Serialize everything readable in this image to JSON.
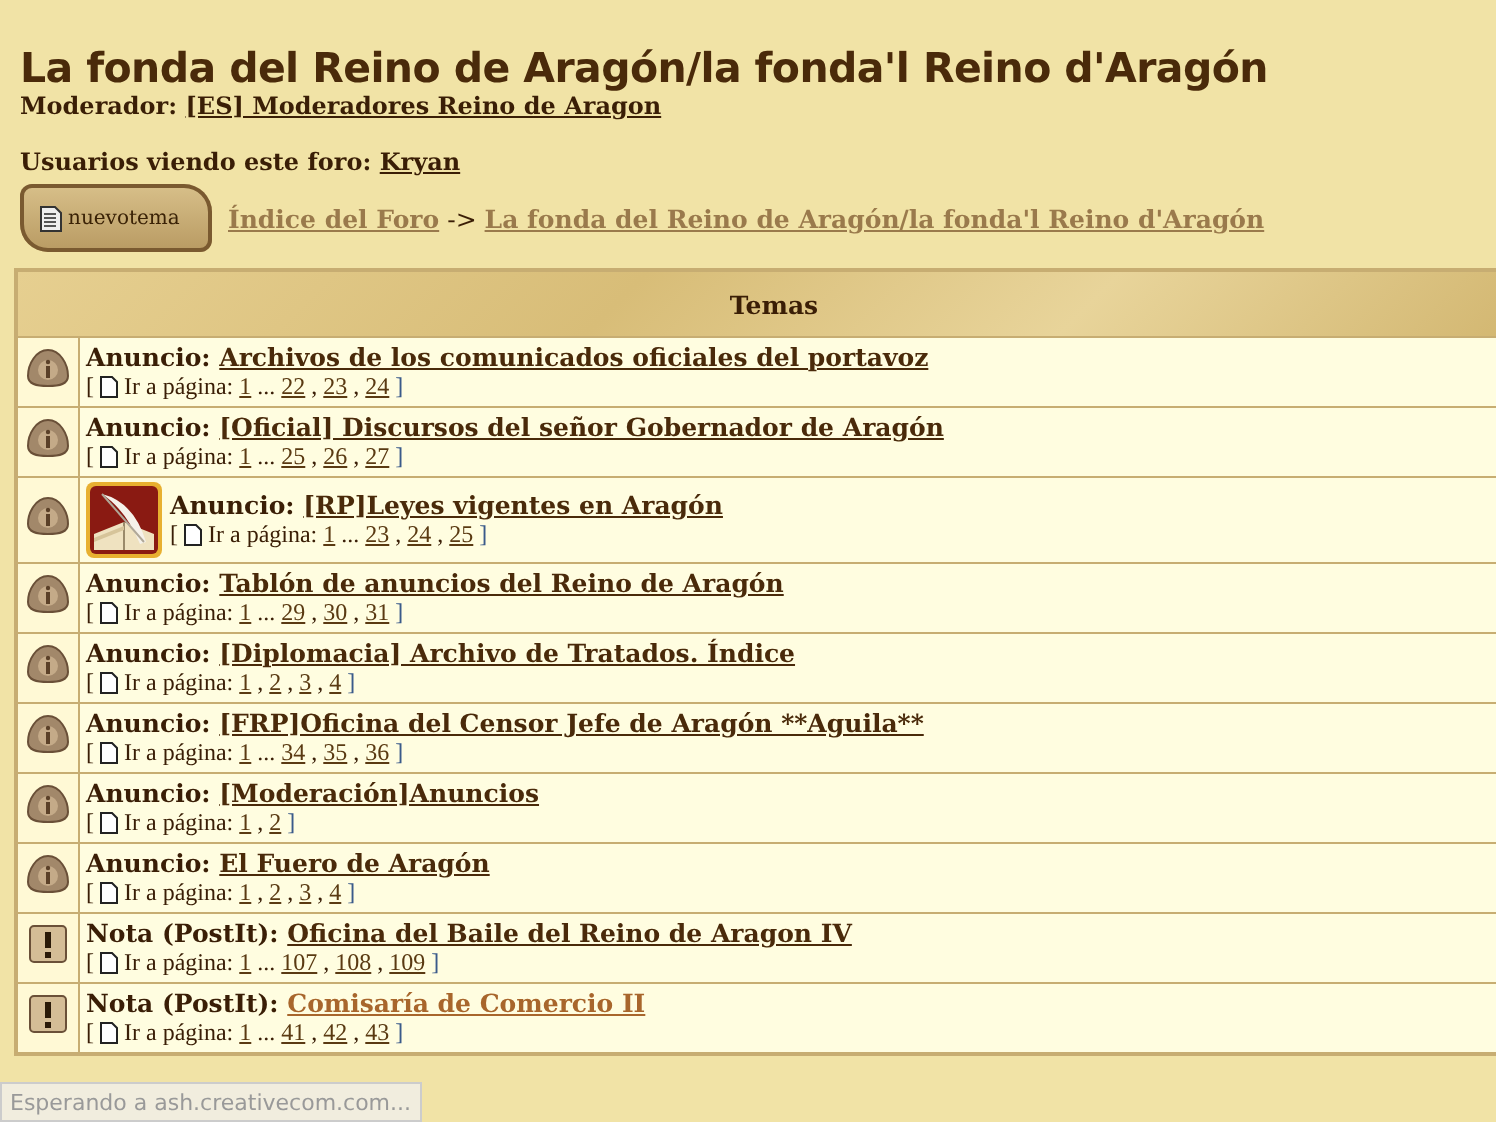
{
  "forum": {
    "title": "La fonda del Reino de Aragón/la fonda'l Reino d'Aragón",
    "moderator_label": "Moderador:",
    "moderator": "[ES] Moderadores Reino de Aragon",
    "viewers_label": "Usuarios viendo este foro:",
    "viewer": "Kryan"
  },
  "new_topic_button": "nuevotema",
  "breadcrumb": [
    {
      "label": "Índice del Foro "
    },
    {
      "label": "La fonda del Reino de Aragón/la fonda'l Reino d'Aragón"
    }
  ],
  "breadcrumb_separator": "->",
  "table": {
    "header": "Temas",
    "open_bracket": "[",
    "close_bracket": "]",
    "page_separator": ",",
    "rows": [
      {
        "kind": "announcement",
        "prefix": "Anuncio:",
        "title": "Archivos de los comunicados oficiales del portavoz",
        "goto": "Ir a página:",
        "pages": [
          "1",
          "...",
          "22",
          "23",
          "24"
        ],
        "highlighted": false
      },
      {
        "kind": "announcement",
        "prefix": "Anuncio:",
        "title": "[Oficial] Discursos del señor Gobernador de Aragón",
        "goto": "Ir a página:",
        "pages": [
          "1",
          "...",
          "25",
          "26",
          "27"
        ],
        "highlighted": false
      },
      {
        "kind": "announcement",
        "prefix": "Anuncio:",
        "title": "[RP]Leyes vigentes en Aragón",
        "goto": "Ir a página:",
        "pages": [
          "1",
          "...",
          "23",
          "24",
          "25"
        ],
        "highlighted": false
      },
      {
        "kind": "announcement",
        "prefix": "Anuncio:",
        "title": "Tablón de anuncios del Reino de Aragón",
        "goto": "Ir a página:",
        "pages": [
          "1",
          "...",
          "29",
          "30",
          "31"
        ],
        "highlighted": false
      },
      {
        "kind": "announcement",
        "prefix": "Anuncio:",
        "title": "[Diplomacia] Archivo de Tratados. Índice",
        "goto": "Ir a página:",
        "pages": [
          "1",
          "2",
          "3",
          "4"
        ],
        "highlighted": false
      },
      {
        "kind": "announcement",
        "prefix": "Anuncio:",
        "title": "[FRP]Oficina del Censor Jefe de Aragón **Aguila**",
        "goto": "Ir a página:",
        "pages": [
          "1",
          "...",
          "34",
          "35",
          "36"
        ],
        "highlighted": false
      },
      {
        "kind": "announcement",
        "prefix": "Anuncio:",
        "title": "[Moderación]Anuncios",
        "goto": "Ir a página:",
        "pages": [
          "1",
          "2"
        ],
        "highlighted": false
      },
      {
        "kind": "announcement",
        "prefix": "Anuncio:",
        "title": "El Fuero de Aragón",
        "goto": "Ir a página:",
        "pages": [
          "1",
          "2",
          "3",
          "4"
        ],
        "highlighted": false
      },
      {
        "kind": "sticky",
        "prefix": "Nota (PostIt):",
        "title": "Oficina del Baile del Reino de Aragon IV",
        "goto": "Ir a página:",
        "pages": [
          "1",
          "...",
          "107",
          "108",
          "109"
        ],
        "highlighted": false
      },
      {
        "kind": "sticky",
        "prefix": "Nota (PostIt):",
        "title": "Comisaría de Comercio II",
        "goto": "Ir a página:",
        "pages": [
          "1",
          "...",
          "41",
          "42",
          "43"
        ],
        "highlighted": true
      }
    ]
  },
  "status_bar": "Esperando a ash.creativecom.com..."
}
